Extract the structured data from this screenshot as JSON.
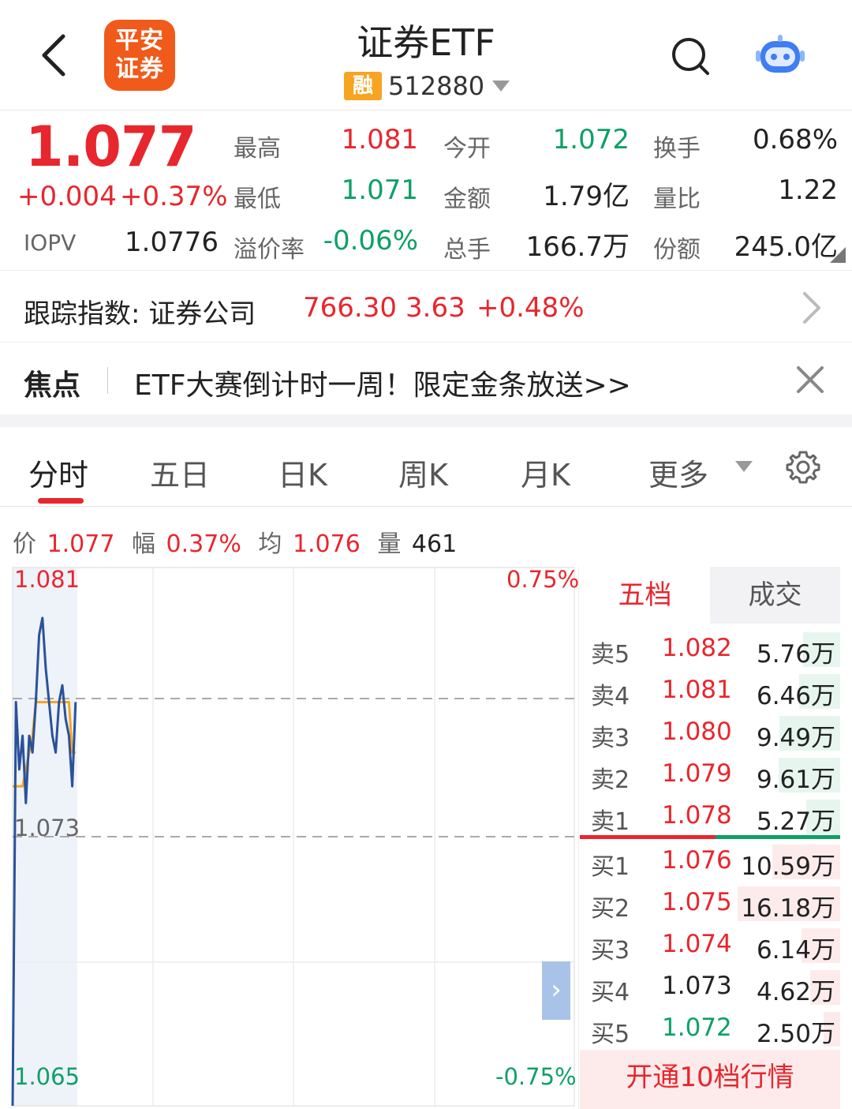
{
  "header": {
    "title": "证券ETF",
    "logo_line1": "平安",
    "logo_line2": "证券",
    "badge": "融",
    "code": "512880"
  },
  "quote": {
    "price": "1.077",
    "change": "+0.004",
    "change_pct": "+0.37%",
    "iopv_label": "IOPV",
    "iopv_value": "1.0776",
    "fields": {
      "high_label": "最高",
      "high": "1.081",
      "open_label": "今开",
      "open": "1.072",
      "turnover_label": "换手",
      "turnover": "0.68%",
      "low_label": "最低",
      "low": "1.071",
      "amount_label": "金额",
      "amount": "1.79亿",
      "vol_ratio_label": "量比",
      "vol_ratio": "1.22",
      "premium_label": "溢价率",
      "premium": "-0.06%",
      "volume_label": "总手",
      "volume": "166.7万",
      "shares_label": "份额",
      "shares": "245.0亿"
    }
  },
  "index": {
    "label": "跟踪指数: 证券公司",
    "value": "766.30",
    "change": "3.63",
    "change_pct": "+0.48%"
  },
  "focus": {
    "label": "焦点",
    "text": "ETF大赛倒计时一周！限定金条放送>>"
  },
  "tabs": {
    "items": [
      "分时",
      "五日",
      "日K",
      "周K",
      "月K",
      "更多"
    ],
    "active": "分时"
  },
  "summary": {
    "price_label": "价",
    "price": "1.077",
    "amp_label": "幅",
    "amp": "0.37%",
    "avg_label": "均",
    "avg": "1.076",
    "vol_label": "量",
    "vol": "461"
  },
  "chart_data": {
    "type": "line",
    "y_labels": {
      "top": "1.081",
      "mid": "1.073",
      "bottom": "1.065"
    },
    "pct_labels": {
      "top": "0.75%",
      "bottom": "-0.75%"
    },
    "ylim": [
      1.065,
      1.081
    ],
    "reference": 1.073,
    "series": [
      {
        "values": [
          1.065,
          1.077,
          1.075,
          1.076,
          1.074,
          1.076,
          1.0755,
          1.077,
          1.079,
          1.0795,
          1.078,
          1.077,
          1.076,
          1.0755,
          1.077,
          1.0775,
          1.0765,
          1.076,
          1.0745,
          1.077
        ]
      },
      {
        "values": [
          1.0745,
          1.0745,
          1.0745,
          1.0745,
          1.075,
          1.0755,
          1.076,
          1.077,
          1.077,
          1.077,
          1.077,
          1.077,
          1.077,
          1.077,
          1.077,
          1.077,
          1.077,
          1.077,
          1.0755,
          1.0755
        ]
      }
    ]
  },
  "book": {
    "tab_five": "五档",
    "tab_deal": "成交",
    "sells": [
      {
        "label": "卖5",
        "price": "1.082",
        "vol": "5.76万",
        "color": "red",
        "bar": 0.36
      },
      {
        "label": "卖4",
        "price": "1.081",
        "vol": "6.46万",
        "color": "red",
        "bar": 0.4
      },
      {
        "label": "卖3",
        "price": "1.080",
        "vol": "9.49万",
        "color": "red",
        "bar": 0.59
      },
      {
        "label": "卖2",
        "price": "1.079",
        "vol": "9.61万",
        "color": "red",
        "bar": 0.6
      },
      {
        "label": "卖1",
        "price": "1.078",
        "vol": "5.27万",
        "color": "red",
        "bar": 0.33
      }
    ],
    "buys": [
      {
        "label": "买1",
        "price": "1.076",
        "vol": "10.59万",
        "color": "red",
        "bar": 0.66
      },
      {
        "label": "买2",
        "price": "1.075",
        "vol": "16.18万",
        "color": "red",
        "bar": 1.0
      },
      {
        "label": "买3",
        "price": "1.074",
        "vol": "6.14万",
        "color": "red",
        "bar": 0.38
      },
      {
        "label": "买4",
        "price": "1.073",
        "vol": "4.62万",
        "color": "dark",
        "bar": 0.29
      },
      {
        "label": "买5",
        "price": "1.072",
        "vol": "2.50万",
        "color": "green",
        "bar": 0.16
      }
    ],
    "more": "开通10档行情"
  },
  "colors": {
    "red": "#e8262d",
    "green": "#0ea066",
    "price_line": "#2a5298",
    "avg_line": "#f5a623"
  }
}
